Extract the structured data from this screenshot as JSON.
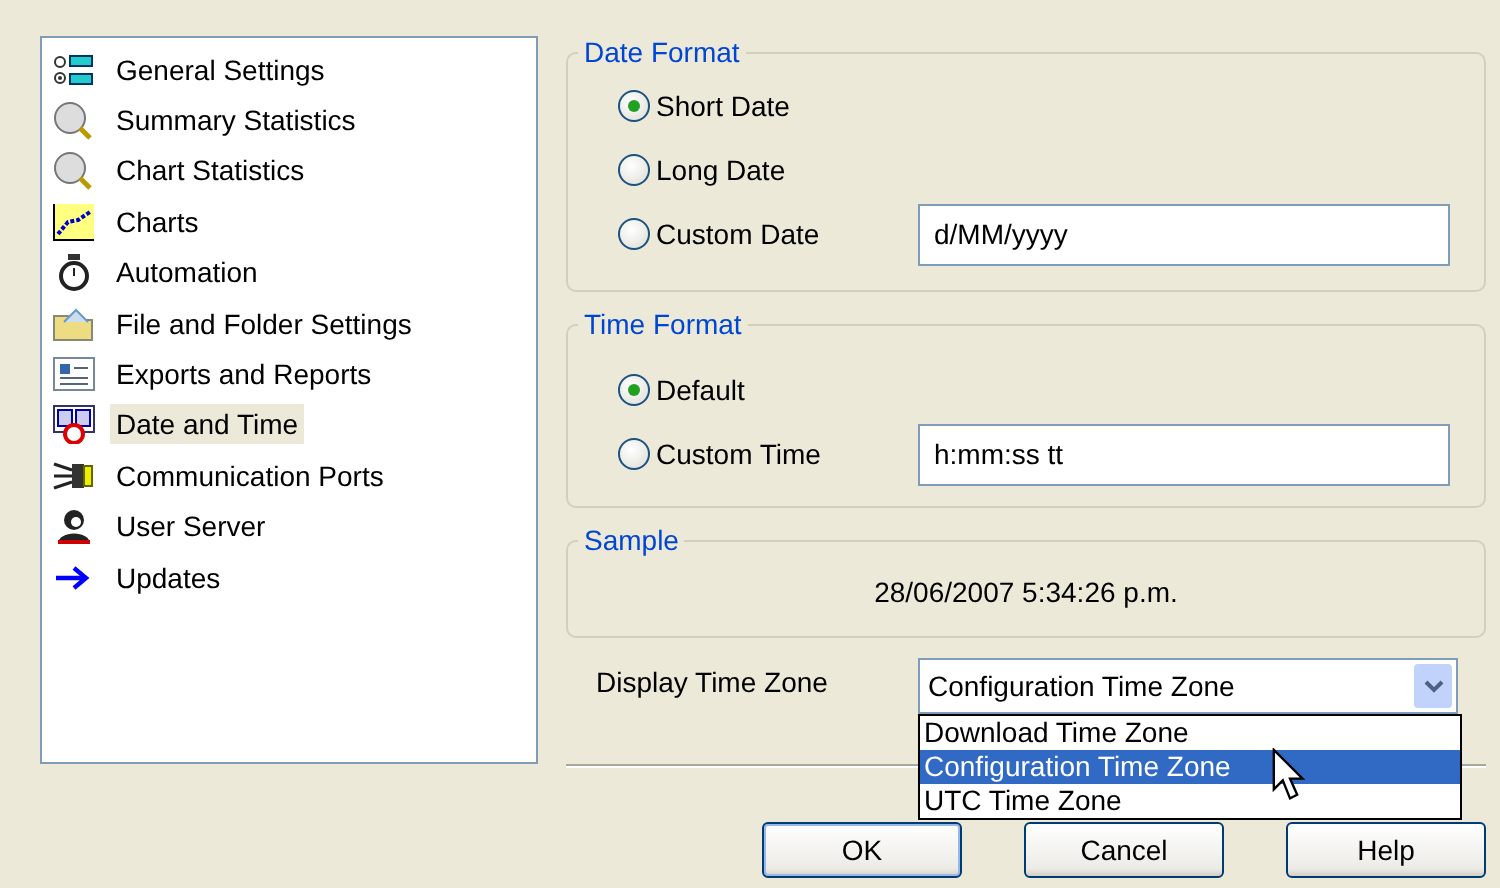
{
  "sidebar": {
    "items": [
      {
        "label": "General Settings",
        "selected": false
      },
      {
        "label": "Summary Statistics",
        "selected": false
      },
      {
        "label": "Chart Statistics",
        "selected": false
      },
      {
        "label": "Charts",
        "selected": false
      },
      {
        "label": "Automation",
        "selected": false
      },
      {
        "label": "File and Folder Settings",
        "selected": false
      },
      {
        "label": "Exports and Reports",
        "selected": false
      },
      {
        "label": "Date and Time",
        "selected": true
      },
      {
        "label": "Communication Ports",
        "selected": false
      },
      {
        "label": "User Server",
        "selected": false
      },
      {
        "label": "Updates",
        "selected": false
      }
    ]
  },
  "date_format": {
    "title": "Date Format",
    "options": [
      {
        "label": "Short Date",
        "selected": true
      },
      {
        "label": "Long Date",
        "selected": false
      },
      {
        "label": "Custom Date",
        "selected": false,
        "value": "d/MM/yyyy"
      }
    ]
  },
  "time_format": {
    "title": "Time Format",
    "options": [
      {
        "label": "Default",
        "selected": true
      },
      {
        "label": "Custom Time",
        "selected": false,
        "value": "h:mm:ss tt"
      }
    ]
  },
  "sample": {
    "title": "Sample",
    "text": "28/06/2007 5:34:26 p.m."
  },
  "time_zone": {
    "label": "Display Time Zone",
    "value": "Configuration Time Zone",
    "expanded": true,
    "options": [
      {
        "label": "Download Time Zone",
        "selected": false
      },
      {
        "label": "Configuration Time Zone",
        "selected": true
      },
      {
        "label": "UTC Time Zone",
        "selected": false
      }
    ]
  },
  "buttons": [
    "OK",
    "Cancel",
    "Help"
  ]
}
